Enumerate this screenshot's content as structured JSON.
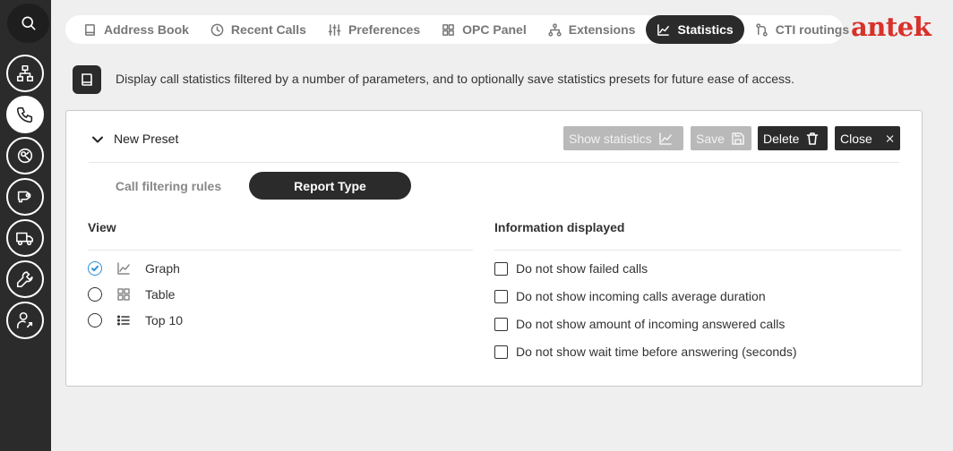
{
  "rail": {
    "items": [
      {
        "icon": "search-icon"
      },
      {
        "icon": "network-icon"
      },
      {
        "icon": "phone-icon",
        "active": true
      },
      {
        "icon": "settings-icon"
      },
      {
        "icon": "camera-icon"
      },
      {
        "icon": "truck-icon"
      },
      {
        "icon": "wrench-icon"
      },
      {
        "icon": "user-settings-icon"
      }
    ]
  },
  "tabs": [
    {
      "label": "Address Book",
      "icon": "book-icon"
    },
    {
      "label": "Recent Calls",
      "icon": "clock-icon"
    },
    {
      "label": "Preferences",
      "icon": "sliders-icon"
    },
    {
      "label": "OPC Panel",
      "icon": "grid-icon"
    },
    {
      "label": "Extensions",
      "icon": "network-icon"
    },
    {
      "label": "Statistics",
      "icon": "chart-icon",
      "active": true
    },
    {
      "label": "CTI routings",
      "icon": "route-icon"
    }
  ],
  "logo": "antek",
  "description": "Display call statistics filtered by a number of parameters, and to optionally save statistics presets for future ease of access.",
  "preset": {
    "title": "New Preset",
    "buttons": {
      "show_statistics": "Show statistics",
      "save": "Save",
      "delete": "Delete",
      "close": "Close"
    }
  },
  "subtabs": {
    "filtering": "Call filtering rules",
    "report_type": "Report Type"
  },
  "view": {
    "title": "View",
    "options": [
      {
        "label": "Graph",
        "checked": true
      },
      {
        "label": "Table",
        "checked": false
      },
      {
        "label": "Top 10",
        "checked": false
      }
    ]
  },
  "info": {
    "title": "Information displayed",
    "options": [
      {
        "label": "Do not show failed calls",
        "checked": false
      },
      {
        "label": "Do not show incoming calls average duration",
        "checked": false
      },
      {
        "label": "Do not show amount of incoming answered calls",
        "checked": false
      },
      {
        "label": "Do not show wait time before answering (seconds)",
        "checked": false
      }
    ]
  },
  "colors": {
    "accent": "#2d8fd5",
    "dark": "#2b2b2b",
    "brand": "#d8312a"
  }
}
